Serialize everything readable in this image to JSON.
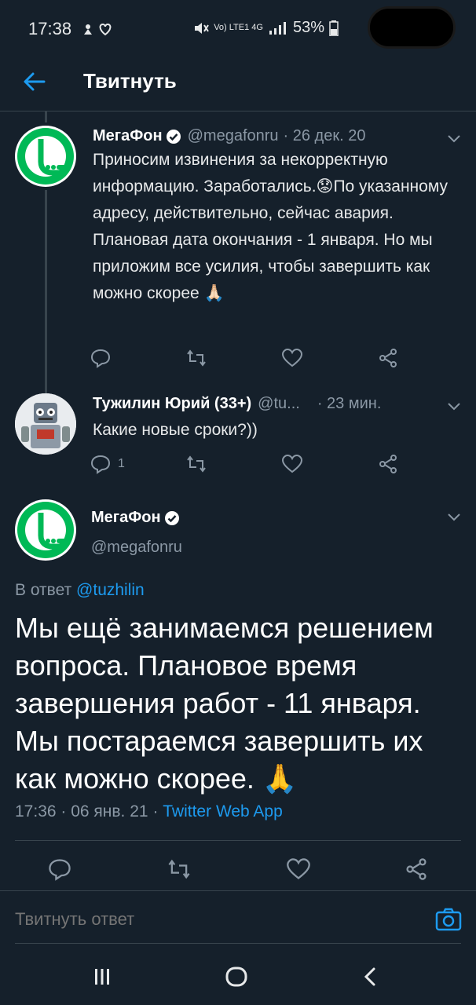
{
  "status_bar": {
    "time": "17:38",
    "signal_text": "Vo) LTE1 4G",
    "battery": "53%"
  },
  "header": {
    "title": "Твитнуть"
  },
  "tweet1": {
    "author": "МегаФон",
    "handle": "@megafonru",
    "date": "· 26 дек. 20",
    "text": "Приносим извинения за некорректную информацию. Заработались.😟По указанному адресу, действительно, сейчас авария. Плановая дата окончания - 1 января. Но мы приложим все усилия, чтобы завершить как можно скорее 🙏🏻"
  },
  "tweet2": {
    "author": "Тужилин Юрий (33+)",
    "handle": "@tu...",
    "date": "· 23 мин.",
    "text": "Какие новые сроки?))",
    "reply_count": "1"
  },
  "main_tweet": {
    "author": "МегаФон",
    "handle": "@megafonru",
    "reply_prefix": "В ответ",
    "reply_to": "@tuzhilin",
    "text": "Мы ещё занимаемся решением вопроса. Плановое время завершения работ - 11 января. Мы постараемся завершить их как можно скорее. 🙏",
    "time": "17:36",
    "date": "06 янв. 21",
    "source": "Twitter Web App"
  },
  "reply_bar": {
    "placeholder": "Твитнуть ответ"
  },
  "colors": {
    "background": "#15202b",
    "accent": "#1d9bf0",
    "megafon_green": "#00b956",
    "muted": "#8b98a5",
    "border": "#38444d"
  },
  "icons": [
    "back-arrow-icon",
    "verified-icon",
    "chevron-down-icon",
    "reply-icon",
    "retweet-icon",
    "like-icon",
    "share-icon",
    "camera-icon",
    "recents-icon",
    "home-icon",
    "back-icon"
  ]
}
